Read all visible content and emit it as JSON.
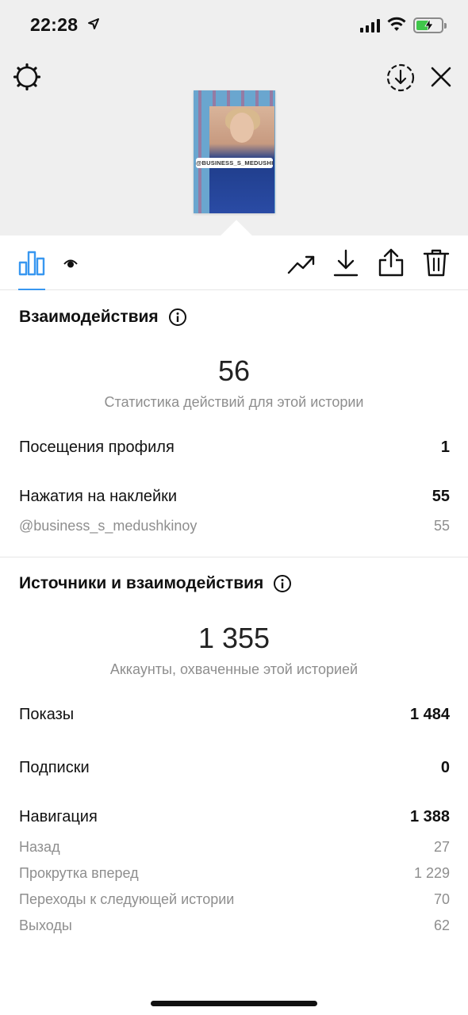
{
  "status_bar": {
    "time": "22:28",
    "icons": [
      "location-arrow-icon",
      "signal-icon",
      "wifi-icon",
      "battery-charging-icon"
    ]
  },
  "header": {
    "left_icon": "gear-icon",
    "right_icons": [
      "save-story-icon",
      "close-icon"
    ]
  },
  "story_preview": {
    "sticker_text": "@BUSINESS_S_MEDUSHKINOY"
  },
  "tabs": {
    "active": "insights",
    "items": [
      "bar-chart-icon",
      "eye-icon"
    ],
    "actions": [
      "promote-icon",
      "download-icon",
      "share-icon",
      "trash-icon"
    ],
    "accent_color": "#3897f0"
  },
  "interactions": {
    "title": "Взаимодействия",
    "total": "56",
    "caption": "Статистика действий для этой истории",
    "rows": [
      {
        "label": "Посещения профиля",
        "value": "1"
      },
      {
        "label": "Нажатия на наклейки",
        "value": "55"
      }
    ],
    "sub_rows": [
      {
        "label": "@business_s_medushkinoy",
        "value": "55"
      }
    ]
  },
  "discovery": {
    "title": "Источники и взаимодействия",
    "total": "1 355",
    "caption": "Аккаунты, охваченные этой историей",
    "rows": [
      {
        "label": "Показы",
        "value": "1 484"
      },
      {
        "label": "Подписки",
        "value": "0"
      },
      {
        "label": "Навигация",
        "value": "1 388"
      }
    ],
    "navigation_breakdown": [
      {
        "label": "Назад",
        "value": "27"
      },
      {
        "label": "Прокрутка вперед",
        "value": "1 229"
      },
      {
        "label": "Переходы к следующей истории",
        "value": "70"
      },
      {
        "label": "Выходы",
        "value": "62"
      }
    ]
  }
}
